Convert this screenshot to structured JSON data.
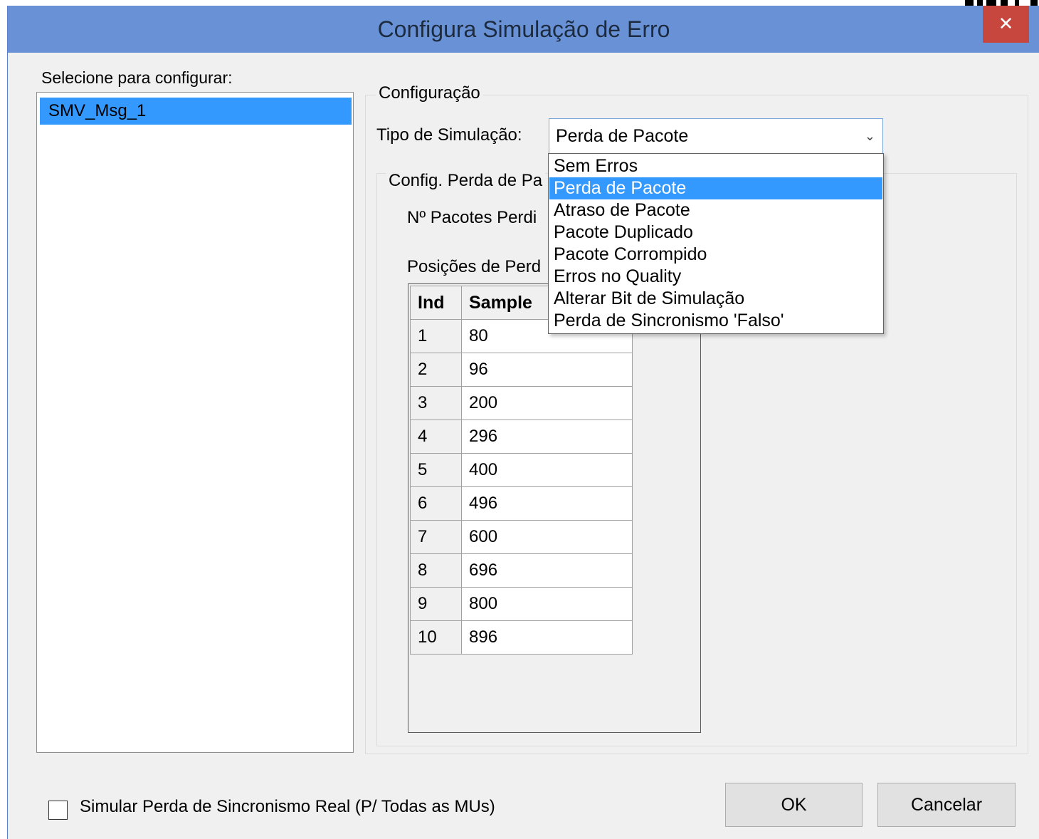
{
  "window": {
    "title": "Configura Simulação de Erro",
    "close_glyph": "✕"
  },
  "left_panel": {
    "label": "Selecione para configurar:",
    "items": [
      "SMV_Msg_1"
    ]
  },
  "config_group": {
    "legend": "Configuração",
    "sim_type_label": "Tipo de Simulação:",
    "sim_type_value": "Perda de Pacote",
    "options": [
      "Sem Erros",
      "Perda de Pacote",
      "Atraso de Pacote",
      "Pacote Duplicado",
      "Pacote Corrompido",
      "Erros no Quality",
      "Alterar Bit de Simulação",
      "Perda de Sincronismo 'Falso'"
    ],
    "selected_option": "Perda de Pacote"
  },
  "loss_group": {
    "legend": "Config. Perda de Pa",
    "lost_packets_label": "Nº Pacotes Perdi",
    "positions_label": "Posições de Perd"
  },
  "grid": {
    "headers": [
      "Ind",
      "Sample"
    ],
    "rows": [
      [
        "1",
        "80"
      ],
      [
        "2",
        "96"
      ],
      [
        "3",
        "200"
      ],
      [
        "4",
        "296"
      ],
      [
        "5",
        "400"
      ],
      [
        "6",
        "496"
      ],
      [
        "7",
        "600"
      ],
      [
        "8",
        "696"
      ],
      [
        "9",
        "800"
      ],
      [
        "10",
        "896"
      ]
    ]
  },
  "footer": {
    "checkbox_label": "Simular Perda de Sincronismo Real (P/ Todas as MUs)",
    "checkbox_checked": false,
    "ok_label": "OK",
    "cancel_label": "Cancelar"
  },
  "colors": {
    "titlebar": "#6991d6",
    "close_button": "#c7463e",
    "selection": "#3399ff",
    "window_bg": "#f0f0f0"
  },
  "icons": {
    "combo_arrow": "chevron-down-icon",
    "close": "close-icon"
  }
}
